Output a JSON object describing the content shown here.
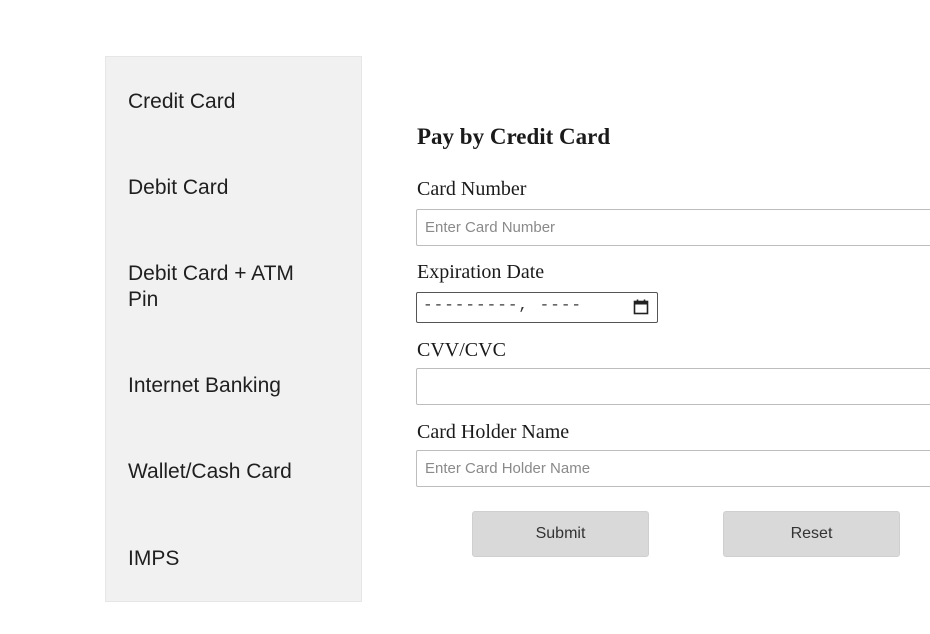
{
  "sidebar": {
    "items": [
      {
        "label": "Credit Card"
      },
      {
        "label": "Debit Card"
      },
      {
        "label": "Debit Card + ATM Pin"
      },
      {
        "label": "Internet Banking"
      },
      {
        "label": "Wallet/Cash Card"
      },
      {
        "label": "IMPS"
      }
    ]
  },
  "form": {
    "title": "Pay by Credit Card",
    "card_number": {
      "label": "Card Number",
      "placeholder": "Enter Card Number",
      "value": ""
    },
    "expiration": {
      "label": "Expiration Date",
      "display": "---------, ----",
      "icon": "calendar-icon"
    },
    "cvv": {
      "label": "CVV/CVC",
      "value": ""
    },
    "holder": {
      "label": "Card Holder Name",
      "placeholder": "Enter Card Holder Name",
      "value": ""
    },
    "submit_label": "Submit",
    "reset_label": "Reset"
  }
}
